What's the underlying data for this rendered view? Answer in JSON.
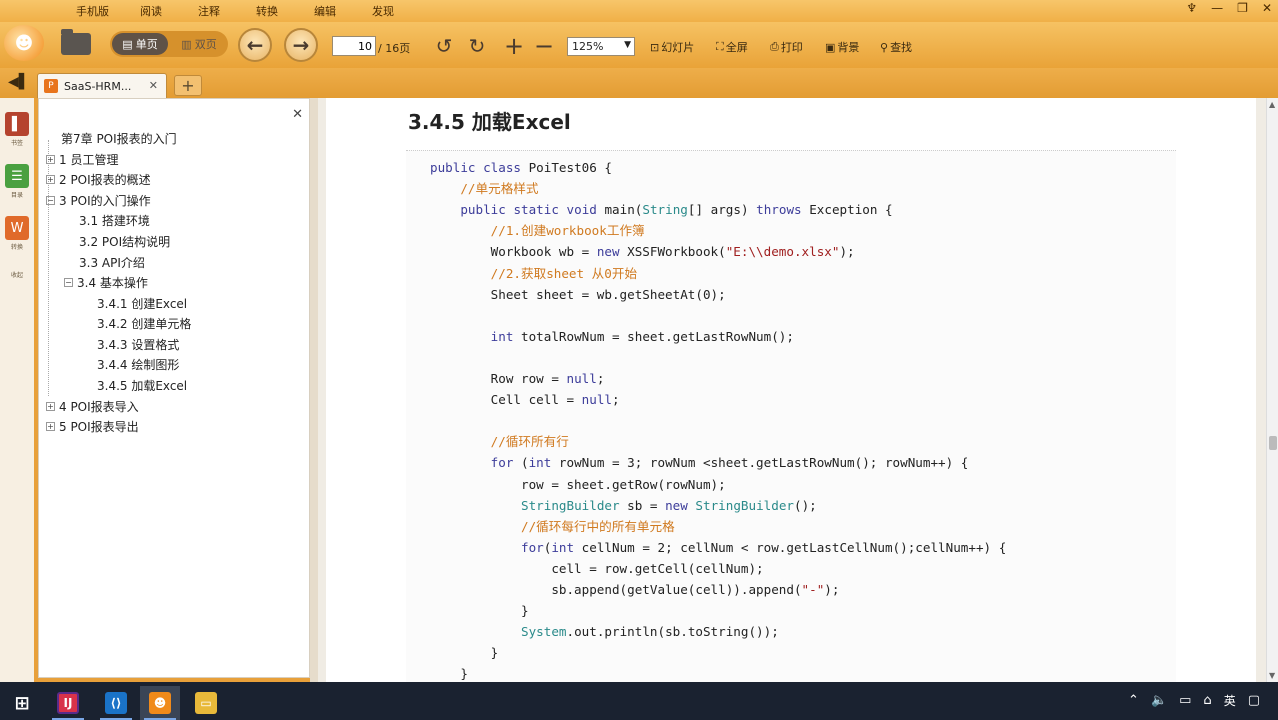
{
  "menu": {
    "items": [
      "手机版",
      "阅读",
      "注释",
      "转换",
      "编辑",
      "发现"
    ]
  },
  "window_controls": [
    "♆",
    "—",
    "❐",
    "✕"
  ],
  "toolbar": {
    "single_label": "单页",
    "double_label": "双页",
    "page_current": "10",
    "page_total": "/ 16页",
    "zoom": "125%",
    "slideshow_label": "幻灯片",
    "fullscreen_label": "全屏",
    "print_label": "打印",
    "background_label": "背景",
    "find_label": "查找"
  },
  "tabs": {
    "doc_tab_label": "SaaS-HRM...",
    "new_tab": "+"
  },
  "sidebar_strip": {
    "items": [
      {
        "label": "书签",
        "icon": "bookmark-icon"
      },
      {
        "label": "目录",
        "icon": "outline-icon"
      },
      {
        "label": "转换",
        "icon": "convert-icon"
      },
      {
        "label": "收起",
        "icon": "collapse-icon"
      }
    ]
  },
  "toc": {
    "items": [
      {
        "label": "第7章 POI报表的入门",
        "expander": ""
      },
      {
        "label": "1 员工管理",
        "expander": "+"
      },
      {
        "label": "2 POI报表的概述",
        "expander": "+"
      },
      {
        "label": "3 POI的入门操作",
        "expander": "−"
      },
      {
        "label": "3.1 搭建环境",
        "expander": ""
      },
      {
        "label": "3.2 POI结构说明",
        "expander": ""
      },
      {
        "label": "3.3 API介绍",
        "expander": ""
      },
      {
        "label": "3.4 基本操作",
        "expander": "−"
      },
      {
        "label": "3.4.1 创建Excel",
        "expander": ""
      },
      {
        "label": "3.4.2 创建单元格",
        "expander": ""
      },
      {
        "label": "3.4.3 设置格式",
        "expander": ""
      },
      {
        "label": "3.4.4 绘制图形",
        "expander": ""
      },
      {
        "label": "3.4.5 加载Excel",
        "expander": ""
      },
      {
        "label": "4 POI报表导入",
        "expander": "+"
      },
      {
        "label": "5 POI报表导出",
        "expander": "+"
      }
    ]
  },
  "document": {
    "section_title": "3.4.5 加载Excel",
    "code_lines": [
      "public class PoiTest06 {",
      "    //单元格样式",
      "    public static void main(String[] args) throws Exception {",
      "        //1.创建workbook工作簿",
      "        Workbook wb = new XSSFWorkbook(\"E:\\\\demo.xlsx\");",
      "        //2.获取sheet 从0开始",
      "        Sheet sheet = wb.getSheetAt(0);",
      "",
      "        int totalRowNum = sheet.getLastRowNum();",
      "",
      "        Row row = null;",
      "        Cell cell = null;",
      "",
      "        //循环所有行",
      "        for (int rowNum = 3; rowNum <sheet.getLastRowNum(); rowNum++) {",
      "            row = sheet.getRow(rowNum);",
      "            StringBuilder sb = new StringBuilder();",
      "            //循环每行中的所有单元格",
      "            for(int cellNum = 2; cellNum < row.getLastCellNum();cellNum++) {",
      "                cell = row.getCell(cellNum);",
      "                sb.append(getValue(cell)).append(\"-\");",
      "            }",
      "            System.out.println(sb.toString());",
      "        }",
      "    }"
    ]
  },
  "taskbar": {
    "apps": [
      {
        "name": "windows-start",
        "icon": "windows-icon"
      },
      {
        "name": "intellij",
        "icon": "intellij-icon"
      },
      {
        "name": "visual-studio-code",
        "icon": "vscode-icon"
      },
      {
        "name": "pdf-reader",
        "icon": "pdf-reader-icon"
      },
      {
        "name": "file-explorer",
        "icon": "folder-icon"
      }
    ],
    "tray": {
      "language": "英"
    }
  },
  "colors": {
    "toolbar_orange": "#f0b047",
    "comment": "#d07a20",
    "keyword": "#3d3d9a",
    "type": "#2a8a8a",
    "taskbar": "#1a2230"
  }
}
